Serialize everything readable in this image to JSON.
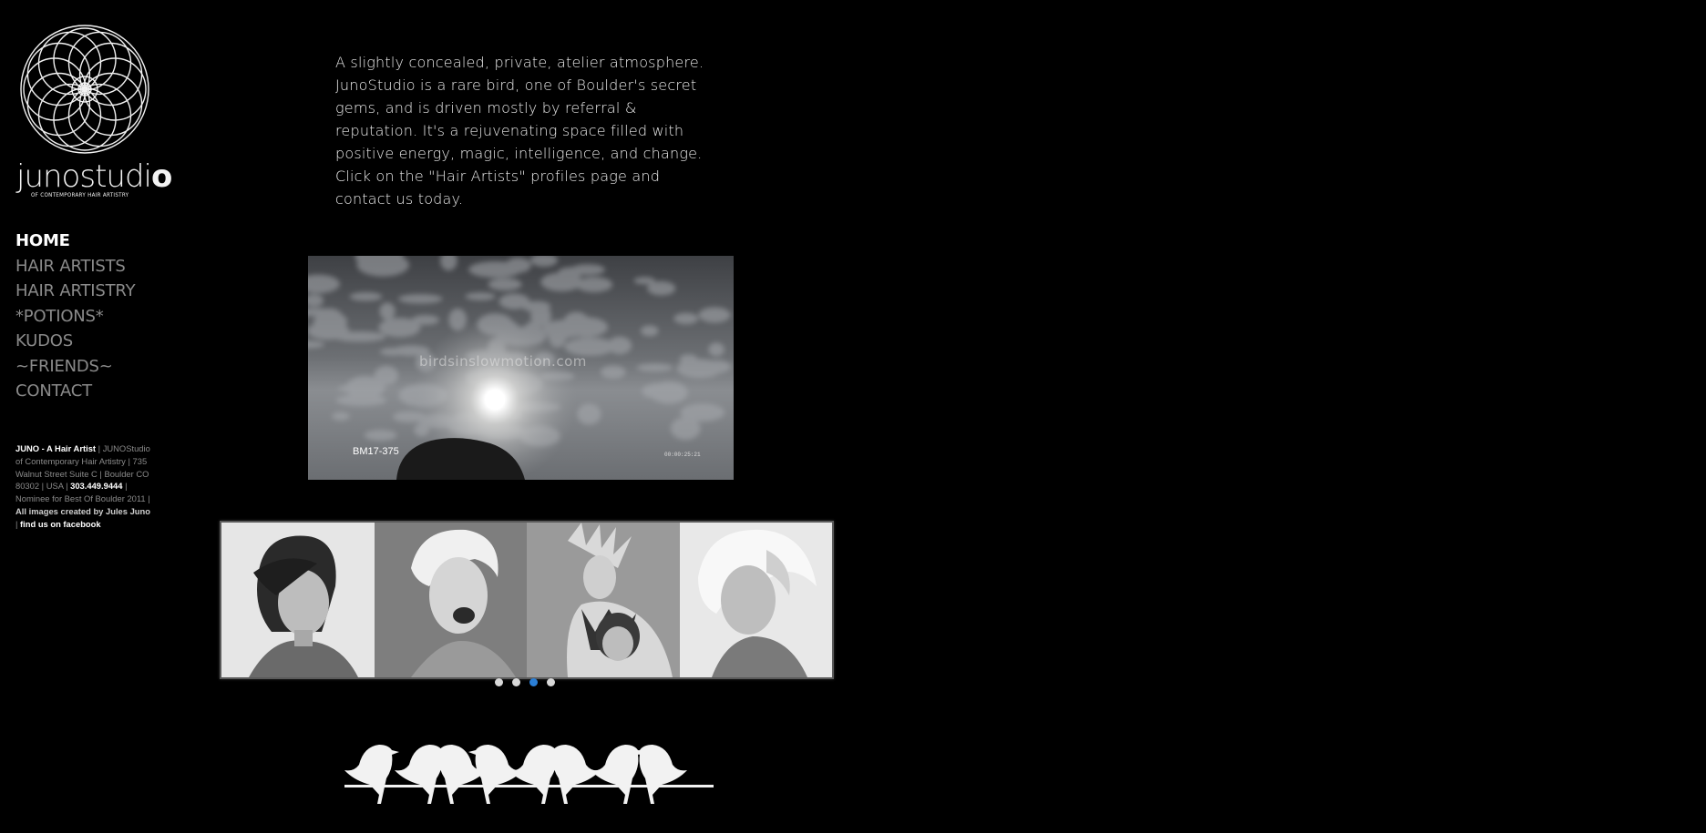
{
  "brand": {
    "name_light": "juno",
    "name_rest": "studi",
    "name_bold": "o",
    "tagline": "OF CONTEMPORARY HAIR ARTISTRY"
  },
  "nav": {
    "items": [
      {
        "label": "HOME",
        "active": true
      },
      {
        "label": "HAIR ARTISTS"
      },
      {
        "label": "HAIR ARTISTRY"
      },
      {
        "label": "*POTIONS*"
      },
      {
        "label": "KUDOS"
      },
      {
        "label": "~FRIENDS~"
      },
      {
        "label": "CONTACT"
      }
    ]
  },
  "sidebar_info": {
    "artist": "JUNO - A Hair Artist",
    "sep1": " | ",
    "studio": "JUNOStudio of Contemporary Hair Artistry | 735 Walnut Street Suite C | Boulder CO 80302 | USA | ",
    "phone": "303.449.9444",
    "nominee": " | Nominee for Best Of Boulder 2011 | ",
    "credit": "All images created by Jules Juno",
    "sep2": " | ",
    "facebook": "find us on facebook"
  },
  "intro": {
    "text": "A slightly concealed, private, atelier atmosphere. JunoStudio is a rare bird, one of Boulder's secret gems, and is driven mostly by referral & reputation. It's a rejuvenating space filled with positive energy, magic, intelligence, and change. Click on the \"Hair Artists\" profiles page and contact us today."
  },
  "video": {
    "watermark": "birdsinslowmotion.com",
    "label": "BM17-375",
    "timecode": "00:00:25:21"
  },
  "gallery": {
    "slide_count": 4,
    "active_index": 2
  },
  "icons": {
    "logo": "mandala-flower-icon",
    "footer": "birds-on-wire-icon"
  },
  "colors": {
    "background": "#000000",
    "nav_inactive": "#8a8a8a",
    "nav_active": "#ffffff",
    "dot_active": "#2b7fd6"
  }
}
